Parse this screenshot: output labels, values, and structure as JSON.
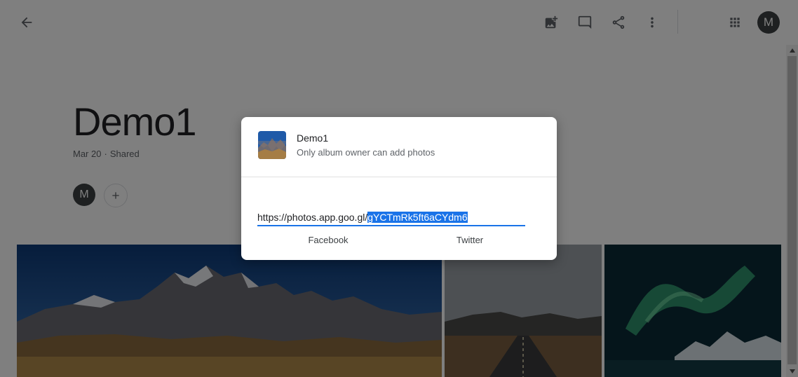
{
  "header": {
    "back_icon": "arrow-back-icon",
    "actions": [
      "add-photo-icon",
      "comment-icon",
      "share-icon",
      "more-vert-icon"
    ],
    "apps_icon": "apps-grid-icon",
    "avatar_initial": "M"
  },
  "album": {
    "title": "Demo1",
    "date": "Mar 20",
    "separator": "·",
    "status": "Shared",
    "member_initial": "M",
    "add_member_icon": "plus-icon"
  },
  "dialog": {
    "album_name": "Demo1",
    "permission_note": "Only album owner can add photos",
    "link_prefix": "https://photos.app.goo.gl/",
    "link_selected": "gYCTmRk5ft6aCYdm6",
    "share_targets": [
      "Facebook",
      "Twitter"
    ]
  },
  "colors": {
    "accent": "#1a73e8",
    "scrim": "rgba(0,0,0,0.5)",
    "avatar": "#3c4043"
  }
}
